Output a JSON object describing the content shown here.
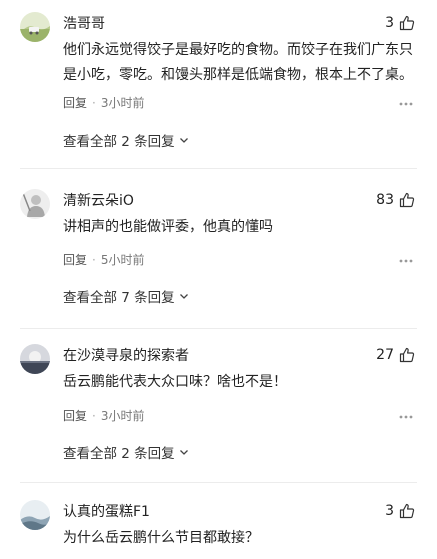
{
  "comments": [
    {
      "user": "浩哥哥",
      "likes": "3",
      "lines": [
        "他们永远觉得饺子是最好吃的食物。而饺子在我们广东只",
        "是小吃，零吃。和馒头那样是低端食物，根本上不了桌。"
      ],
      "reply_label": "回复",
      "time": "3小时前",
      "view_replies": "查看全部 2 条回复"
    },
    {
      "user": "清新云朵iO",
      "likes": "83",
      "lines": [
        "讲相声的也能做评委，他真的懂吗"
      ],
      "reply_label": "回复",
      "time": "5小时前",
      "view_replies": "查看全部 7 条回复"
    },
    {
      "user": "在沙漠寻泉的探索者",
      "likes": "27",
      "lines": [
        "岳云鹏能代表大众口味？啥也不是！"
      ],
      "reply_label": "回复",
      "time": "3小时前",
      "view_replies": "查看全部 2 条回复"
    },
    {
      "user": "认真的蛋糕F1",
      "likes": "3",
      "lines": [
        "为什么岳云鹏什么节目都敢接？"
      ]
    }
  ],
  "meta_separator": "·",
  "icons": {
    "like": "thumbs-up-icon",
    "more": "more-dots-icon",
    "expand": "chevron-down-icon"
  },
  "colors": {
    "text": "#222222",
    "meta": "#777777",
    "divider": "#ececec"
  }
}
